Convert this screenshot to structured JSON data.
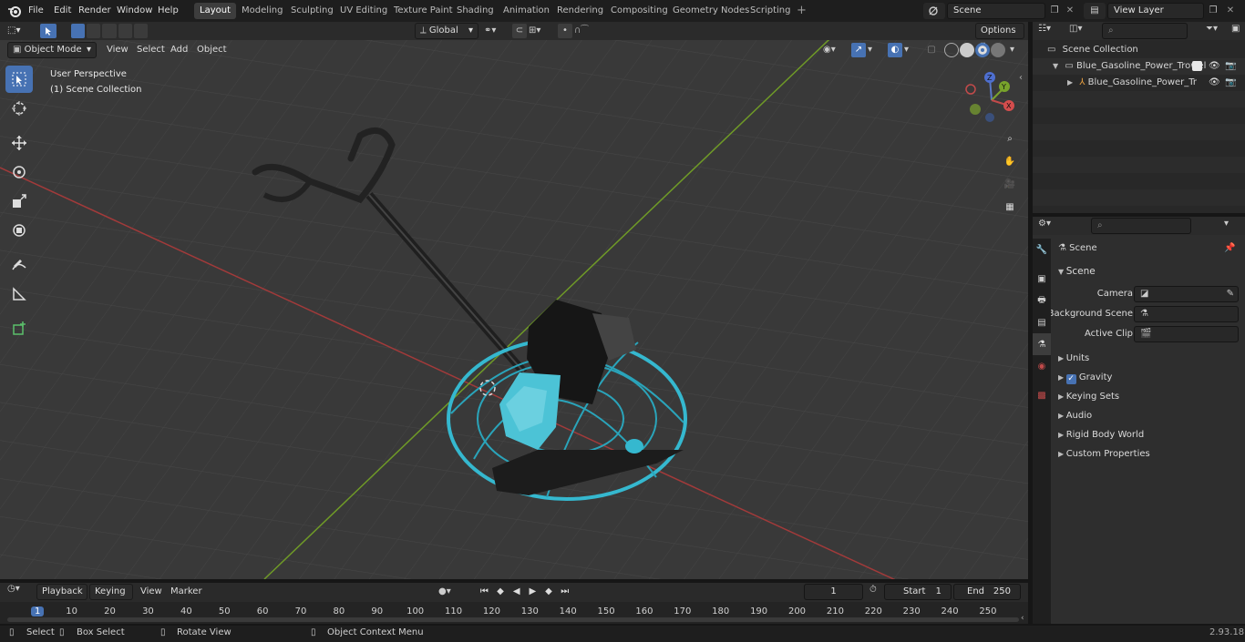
{
  "topbar": {
    "menus": [
      "File",
      "Edit",
      "Render",
      "Window",
      "Help"
    ],
    "workspaces": [
      "Layout",
      "Modeling",
      "Sculpting",
      "UV Editing",
      "Texture Paint",
      "Shading",
      "Animation",
      "Rendering",
      "Compositing",
      "Geometry Nodes",
      "Scripting"
    ],
    "active_workspace": "Layout",
    "add_tab": "+",
    "scene_name": "Scene",
    "view_layer": "View Layer"
  },
  "viewport": {
    "transform_orientation": "Global",
    "options_label": "Options",
    "mode": "Object Mode",
    "menus": [
      "View",
      "Select",
      "Add",
      "Object"
    ],
    "perspective_label": "User Perspective",
    "collection_label": "(1) Scene Collection",
    "gizmo_axes": [
      "Z",
      "Y",
      "X"
    ]
  },
  "outliner": {
    "root": "Scene Collection",
    "items": [
      {
        "label": "Blue_Gasoline_Power_Trowel",
        "level": 1
      },
      {
        "label": "Blue_Gasoline_Power_Tr",
        "level": 2
      }
    ]
  },
  "properties": {
    "context": "Scene",
    "panel_title": "Scene",
    "fields": [
      {
        "label": "Camera",
        "value": ""
      },
      {
        "label": "Background Scene",
        "value": ""
      },
      {
        "label": "Active Clip",
        "value": ""
      }
    ],
    "sections": [
      "Units",
      "Gravity",
      "Keying Sets",
      "Audio",
      "Rigid Body World",
      "Custom Properties"
    ],
    "gravity_enabled": true
  },
  "timeline": {
    "menus": [
      "Playback",
      "Keying",
      "View",
      "Marker"
    ],
    "current_frame": "1",
    "start_label": "Start",
    "start_value": "1",
    "end_label": "End",
    "end_value": "250",
    "ruler": [
      "1",
      "10",
      "20",
      "30",
      "40",
      "50",
      "60",
      "70",
      "80",
      "90",
      "100",
      "110",
      "120",
      "130",
      "140",
      "150",
      "160",
      "170",
      "180",
      "190",
      "200",
      "210",
      "220",
      "230",
      "240",
      "250"
    ]
  },
  "statusbar": {
    "items": [
      "Select",
      "Box Select",
      "Rotate View",
      "Object Context Menu"
    ],
    "version": "2.93.18"
  },
  "colors": {
    "accent": "#4772b3",
    "object_cyan": "#35b8cf",
    "x_axis": "#b84848",
    "y_axis": "#7aa22d"
  }
}
